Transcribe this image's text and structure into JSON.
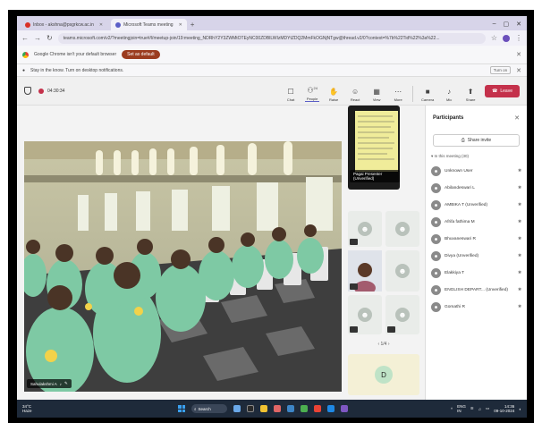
{
  "browser": {
    "tabs": [
      {
        "label": "Inbox - akshna@psgrkcw.ac.in",
        "active": false,
        "fav_color": "#d93025"
      },
      {
        "label": "Microsoft Teams meeting",
        "active": true,
        "fav_color": "#5b5fc7"
      }
    ],
    "new_tab": "+",
    "address": "teams.microsoft.com/v2/?meetingjoin=true#/l/meetup-join/19:meeting_NDRhY2Y3ZWMtOTEyNC00ZDBlLWIzMDYtZDQ2MmFkOGNjNTgw@thread.v2/0?context=%7b%22Tid%22%3a%22..."
  },
  "infobars": {
    "default_browser": "Google Chrome isn't your default browser",
    "set_default": "Set as default",
    "notifications": "Stay in the know. Turn on desktop notifications.",
    "turn_on": "Turn on"
  },
  "toolbar": {
    "timer": "04:30:34",
    "tools": [
      {
        "label": "Chat",
        "icon": "☐"
      },
      {
        "label": "People",
        "icon": "⚇",
        "badge": "24"
      },
      {
        "label": "Raise",
        "icon": "✋"
      },
      {
        "label": "React",
        "icon": "☺"
      },
      {
        "label": "View",
        "icon": "▦"
      },
      {
        "label": "More",
        "icon": "⋯"
      }
    ],
    "devices": [
      {
        "label": "Camera",
        "icon": "■"
      },
      {
        "label": "Mic",
        "icon": "♪"
      },
      {
        "label": "Share",
        "icon": "⬆"
      }
    ],
    "leave": "Leave"
  },
  "stage": {
    "label": "Sahulakshmi A"
  },
  "tiles": {
    "presenter_label": "Pagai Presenter (Unverified)",
    "pager": "1/4",
    "letter_avatar": "D"
  },
  "participants": {
    "title": "Participants",
    "share_invite": "Share invite",
    "section": "In this meeting (30)",
    "list": [
      "Unknown User",
      "Abilandeswari L",
      "AMBIKA T (Unverified)",
      "Afrifa fathima M",
      "Bhuvaneswari R",
      "Divya (Unverified)",
      "Elakkiya T",
      "ENGLISH DEPART... (Unverified)",
      "Gomathi R"
    ]
  },
  "taskbar": {
    "weather_temp": "34°C",
    "weather_desc": "Haze",
    "search": "Search",
    "lang": "ENG",
    "region": "IN",
    "time": "14:36",
    "date": "09-10-2024"
  }
}
